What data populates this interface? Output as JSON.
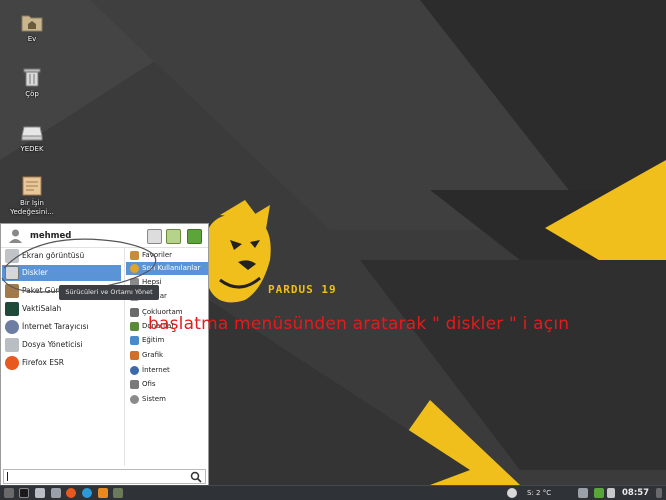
{
  "desktop": {
    "icons": [
      {
        "label": "Ev",
        "icon": "home-folder-icon"
      },
      {
        "label": "Çöp",
        "icon": "trash-icon"
      },
      {
        "label": "YEDEK",
        "icon": "drive-icon"
      },
      {
        "label_line1": "Bir İşin",
        "label_line2": "Yedeğesini...",
        "icon": "document-icon"
      }
    ],
    "wallpaper_logo": "PARDUS 19"
  },
  "start_menu": {
    "user_name": "mehmed",
    "apps": [
      {
        "label": "Ekran görüntüsü",
        "icon": "screenshot-icon"
      },
      {
        "label": "Diskler",
        "icon": "disks-icon",
        "selected": true
      },
      {
        "label": "Paket Güne",
        "icon": "package-icon"
      },
      {
        "label": "VaktiSalah",
        "icon": "prayer-time-icon"
      },
      {
        "label": "İnternet Tarayıcısı",
        "icon": "web-browser-icon"
      },
      {
        "label": "Dosya Yöneticisi",
        "icon": "file-manager-icon"
      },
      {
        "label": "Firefox ESR",
        "icon": "firefox-icon"
      }
    ],
    "categories": [
      {
        "label": "Favoriler"
      },
      {
        "label": "Son Kullanılanlar",
        "selected": true
      },
      {
        "label": "Hepsi"
      },
      {
        "label": "Araçlar"
      },
      {
        "label": "Çokluortam"
      },
      {
        "label": "Donatılar"
      },
      {
        "label": "Eğitim"
      },
      {
        "label": "Grafik"
      },
      {
        "label": "İnternet"
      },
      {
        "label": "Ofis"
      },
      {
        "label": "Sistem"
      }
    ],
    "search_placeholder": ""
  },
  "tooltip": {
    "text": "Sürücüleri ve Ortamı Yönet"
  },
  "annotation": {
    "text": "başlatma menüsünden aratarak \" diskler \" i açın",
    "color": "#e31b1b"
  },
  "taskbar": {
    "weather": "S: 2 °C",
    "clock": "08:57"
  },
  "colors": {
    "accent": "#f0bf1b",
    "selection": "#5b94d6",
    "annotation": "#e31b1b"
  }
}
